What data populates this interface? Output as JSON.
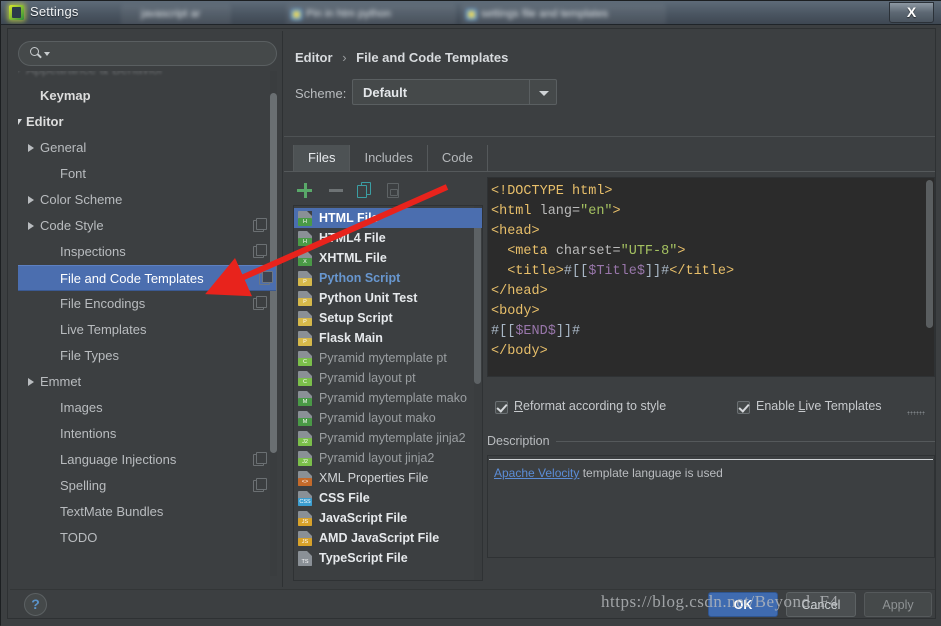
{
  "window": {
    "title": "Settings",
    "close_label": "X",
    "background_tabs": [
      "",
      "",
      ""
    ]
  },
  "sidebar": {
    "search": {
      "value": "",
      "placeholder": ""
    },
    "items": [
      {
        "label": "Appearance & Behavior",
        "indent": 0,
        "expander": "collapsed",
        "bold": false,
        "clipped": true,
        "selected": false,
        "copyable": false
      },
      {
        "label": "Keymap",
        "indent": 1,
        "expander": "none",
        "bold": true,
        "clipped": false,
        "selected": false,
        "copyable": false
      },
      {
        "label": "Editor",
        "indent": 0,
        "expander": "expanded",
        "bold": true,
        "clipped": false,
        "selected": false,
        "copyable": false
      },
      {
        "label": "General",
        "indent": 1,
        "expander": "collapsed",
        "bold": false,
        "clipped": false,
        "selected": false,
        "copyable": false
      },
      {
        "label": "Font",
        "indent": 2,
        "expander": "none",
        "bold": false,
        "clipped": false,
        "selected": false,
        "copyable": false
      },
      {
        "label": "Color Scheme",
        "indent": 1,
        "expander": "collapsed",
        "bold": false,
        "clipped": false,
        "selected": false,
        "copyable": false
      },
      {
        "label": "Code Style",
        "indent": 1,
        "expander": "collapsed",
        "bold": false,
        "clipped": false,
        "selected": false,
        "copyable": true
      },
      {
        "label": "Inspections",
        "indent": 2,
        "expander": "none",
        "bold": false,
        "clipped": false,
        "selected": false,
        "copyable": true
      },
      {
        "label": "File and Code Templates",
        "indent": 2,
        "expander": "none",
        "bold": false,
        "clipped": false,
        "selected": true,
        "copyable": true
      },
      {
        "label": "File Encodings",
        "indent": 2,
        "expander": "none",
        "bold": false,
        "clipped": false,
        "selected": false,
        "copyable": true
      },
      {
        "label": "Live Templates",
        "indent": 2,
        "expander": "none",
        "bold": false,
        "clipped": false,
        "selected": false,
        "copyable": false
      },
      {
        "label": "File Types",
        "indent": 2,
        "expander": "none",
        "bold": false,
        "clipped": false,
        "selected": false,
        "copyable": false
      },
      {
        "label": "Emmet",
        "indent": 1,
        "expander": "collapsed",
        "bold": false,
        "clipped": false,
        "selected": false,
        "copyable": false
      },
      {
        "label": "Images",
        "indent": 2,
        "expander": "none",
        "bold": false,
        "clipped": false,
        "selected": false,
        "copyable": false
      },
      {
        "label": "Intentions",
        "indent": 2,
        "expander": "none",
        "bold": false,
        "clipped": false,
        "selected": false,
        "copyable": false
      },
      {
        "label": "Language Injections",
        "indent": 2,
        "expander": "none",
        "bold": false,
        "clipped": false,
        "selected": false,
        "copyable": true
      },
      {
        "label": "Spelling",
        "indent": 2,
        "expander": "none",
        "bold": false,
        "clipped": false,
        "selected": false,
        "copyable": true
      },
      {
        "label": "TextMate Bundles",
        "indent": 2,
        "expander": "none",
        "bold": false,
        "clipped": false,
        "selected": false,
        "copyable": false
      },
      {
        "label": "TODO",
        "indent": 2,
        "expander": "none",
        "bold": false,
        "clipped": false,
        "selected": false,
        "copyable": false
      }
    ]
  },
  "main": {
    "breadcrumb": {
      "parent": "Editor",
      "separator": "›",
      "current": "File and Code Templates"
    },
    "scheme": {
      "label": "Scheme:",
      "value": "Default"
    },
    "tabs": [
      {
        "label": "Files",
        "active": true
      },
      {
        "label": "Includes",
        "active": false
      },
      {
        "label": "Code",
        "active": false
      }
    ],
    "toolbar": [
      {
        "name": "add",
        "glyph": "+"
      },
      {
        "name": "remove",
        "glyph": "−"
      },
      {
        "name": "copy",
        "glyph": "copy"
      },
      {
        "name": "reset",
        "glyph": "reset"
      }
    ],
    "templates": [
      {
        "label": "HTML File",
        "style": "white-bold",
        "tag": "H",
        "tagColor": "#4a9a46",
        "selected": true
      },
      {
        "label": "HTML4 File",
        "style": "white-bold",
        "tag": "H",
        "tagColor": "#4a9a46",
        "selected": false
      },
      {
        "label": "XHTML File",
        "style": "white-bold",
        "tag": "X",
        "tagColor": "#4a9a46",
        "selected": false
      },
      {
        "label": "Python Script",
        "style": "blue-bold",
        "tag": "P",
        "tagColor": "#d6b94a",
        "selected": false
      },
      {
        "label": "Python Unit Test",
        "style": "white-bold",
        "tag": "P",
        "tagColor": "#d6b94a",
        "selected": false
      },
      {
        "label": "Setup Script",
        "style": "white-bold",
        "tag": "P",
        "tagColor": "#d6b94a",
        "selected": false
      },
      {
        "label": "Flask Main",
        "style": "white-bold",
        "tag": "P",
        "tagColor": "#d6b94a",
        "selected": false
      },
      {
        "label": "Pyramid mytemplate pt",
        "style": "gray",
        "tag": "C",
        "tagColor": "#7bbf4a",
        "selected": false
      },
      {
        "label": "Pyramid layout pt",
        "style": "gray",
        "tag": "C",
        "tagColor": "#7bbf4a",
        "selected": false
      },
      {
        "label": "Pyramid mytemplate mako",
        "style": "gray",
        "tag": "M",
        "tagColor": "#4a9a46",
        "selected": false
      },
      {
        "label": "Pyramid layout mako",
        "style": "gray",
        "tag": "M",
        "tagColor": "#4a9a46",
        "selected": false
      },
      {
        "label": "Pyramid mytemplate jinja2",
        "style": "gray",
        "tag": "J2",
        "tagColor": "#7bbf4a",
        "selected": false
      },
      {
        "label": "Pyramid layout jinja2",
        "style": "gray",
        "tag": "J2",
        "tagColor": "#7bbf4a",
        "selected": false
      },
      {
        "label": "XML Properties File",
        "style": "white",
        "tag": "<>",
        "tagColor": "#c46a2a",
        "selected": false
      },
      {
        "label": "CSS File",
        "style": "white-bold",
        "tag": "CSS",
        "tagColor": "#3b9ed1",
        "selected": false
      },
      {
        "label": "JavaScript File",
        "style": "white-bold",
        "tag": "JS",
        "tagColor": "#d8a22a",
        "selected": false
      },
      {
        "label": "AMD JavaScript File",
        "style": "white-bold",
        "tag": "JS",
        "tagColor": "#d8a22a",
        "selected": false
      },
      {
        "label": "TypeScript File",
        "style": "white-bold",
        "tag": "TS",
        "tagColor": "#8a9096",
        "selected": false
      }
    ],
    "editor": {
      "lines": [
        [
          {
            "t": "<!DOCTYPE html>",
            "c": "tk-tag"
          }
        ],
        [
          {
            "t": "<html ",
            "c": "tk-tag"
          },
          {
            "t": "lang=",
            "c": "tk-attr"
          },
          {
            "t": "\"en\"",
            "c": "tk-val"
          },
          {
            "t": ">",
            "c": "tk-tag"
          }
        ],
        [
          {
            "t": "<head>",
            "c": "tk-tag"
          }
        ],
        [
          {
            "t": "  <meta ",
            "c": "tk-tag"
          },
          {
            "t": "charset=",
            "c": "tk-attr"
          },
          {
            "t": "\"UTF-8\"",
            "c": "tk-val"
          },
          {
            "t": ">",
            "c": "tk-tag"
          }
        ],
        [
          {
            "t": "  <title>",
            "c": "tk-tag"
          },
          {
            "t": "#[[",
            "c": "tk-plain"
          },
          {
            "t": "$Title$",
            "c": "tk-var"
          },
          {
            "t": "]]#",
            "c": "tk-plain"
          },
          {
            "t": "</title>",
            "c": "tk-tag"
          }
        ],
        [
          {
            "t": "</head>",
            "c": "tk-tag"
          }
        ],
        [
          {
            "t": "<body>",
            "c": "tk-tag"
          }
        ],
        [
          {
            "t": "#[[",
            "c": "tk-plain"
          },
          {
            "t": "$END$",
            "c": "tk-var"
          },
          {
            "t": "]]#",
            "c": "tk-plain"
          }
        ],
        [
          {
            "t": "</body>",
            "c": "tk-tag"
          }
        ]
      ]
    },
    "checkboxes": [
      {
        "label_pre": "",
        "label_underline": "R",
        "label_post": "eformat according to style",
        "checked": true
      },
      {
        "label_pre": "Enable ",
        "label_underline": "L",
        "label_post": "ive Templates",
        "checked": true
      }
    ],
    "description": {
      "title": "Description",
      "link_text": "Apache Velocity",
      "body_text": " template language is used"
    }
  },
  "footer": {
    "help_label": "?",
    "ok_label": "OK",
    "cancel_label": "Cancel",
    "apply_label": "Apply"
  },
  "watermark": "https://blog.csdn.net/Beyond_F4",
  "colors": {
    "accent_selection": "#4b6eaf",
    "window_bg": "#3c3f41",
    "editor_bg": "#2b2b2b",
    "ok_button": "#3f6bb0",
    "annotation_arrow": "#e8231c",
    "add_icon": "#59a869"
  }
}
